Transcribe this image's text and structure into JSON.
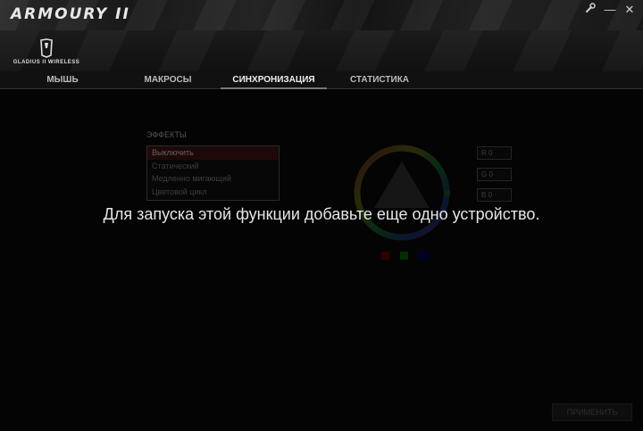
{
  "window": {
    "title": "ARMOURY II",
    "settings_icon": "wrench-icon",
    "minimize_label": "—",
    "close_label": "✕"
  },
  "device": {
    "name": "GLADIUS II WIRELESS",
    "icon": "rog-mouse-logo-icon"
  },
  "tabs": [
    {
      "label": "МЫШЬ",
      "active": false
    },
    {
      "label": "МАКРОСЫ",
      "active": false
    },
    {
      "label": "СИНХРОНИЗАЦИЯ",
      "active": true
    },
    {
      "label": "СТАТИСТИКА",
      "active": false
    }
  ],
  "effects": {
    "title": "ЭФФЕКТЫ",
    "items": [
      "Выключить",
      "Статический",
      "Медленно мигающий",
      "Цветовой цикл"
    ],
    "selected_index": 0
  },
  "color": {
    "fields": [
      "0",
      "0",
      "0"
    ],
    "field_labels": [
      "R",
      "G",
      "B"
    ],
    "swatches": [
      "#c00000",
      "#00a000",
      "#0000c0"
    ]
  },
  "overlay": {
    "message": "Для запуска этой функции добавьте еще одно устройство."
  },
  "footer": {
    "apply_label": "ПРИМЕНИТЬ"
  }
}
